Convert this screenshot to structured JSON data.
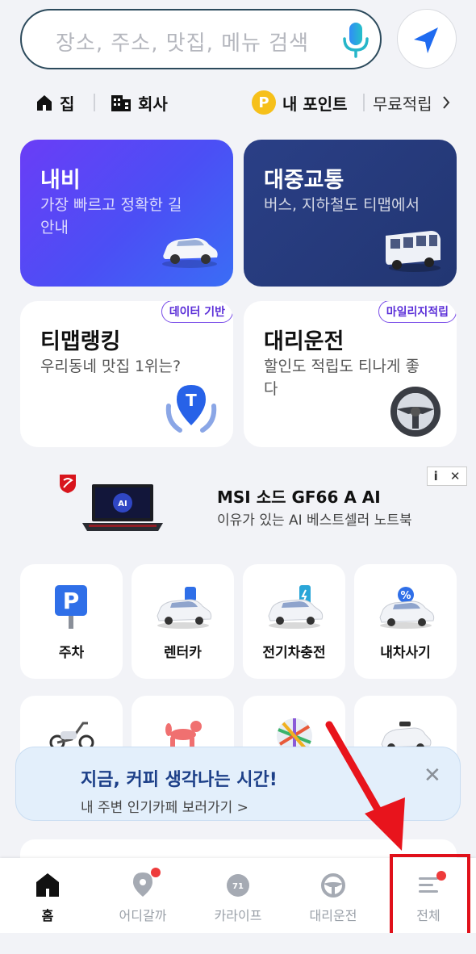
{
  "search": {
    "placeholder": "장소, 주소, 맛집, 메뉴 검색"
  },
  "quick_places": [
    {
      "label": "집"
    },
    {
      "label": "회사"
    }
  ],
  "points": {
    "coin": "P",
    "label": "내 포인트",
    "free_label": "무료적립"
  },
  "cards": {
    "navi": {
      "title": "내비",
      "sub": "가장 빠르고 정확한 길안내"
    },
    "transit": {
      "title": "대중교통",
      "sub": "버스, 지하철도 티맵에서"
    },
    "ranking": {
      "title": "티맵랭킹",
      "sub": "우리동네 맛집 1위는?",
      "tag": "데이터 기반"
    },
    "driver": {
      "title": "대리운전",
      "sub": "할인도 적립도 티나게 좋다",
      "tag": "마일리지적립"
    }
  },
  "ad": {
    "title": "MSI 소드 GF66 A AI",
    "sub": "이유가 있는 AI 베스트셀러 노트북",
    "info": "i",
    "close": "✕",
    "laptop_screen_text": "AI"
  },
  "services": [
    {
      "label": "주차",
      "sign": "P"
    },
    {
      "label": "렌터카"
    },
    {
      "label": "전기차충전"
    },
    {
      "label": "내차사기",
      "badge": "%"
    }
  ],
  "banner": {
    "title": "지금, 커피 생각나는 시간!",
    "sub": "내 주변 인기카페 보러가기 >",
    "close": "✕"
  },
  "tabbar": {
    "items": [
      {
        "label": "홈"
      },
      {
        "label": "어디갈까"
      },
      {
        "label": "카라이프",
        "badge": "71"
      },
      {
        "label": "대리운전"
      },
      {
        "label": "전체"
      }
    ]
  },
  "colors": {
    "accent_red": "#e0101a",
    "navi_gradient": "#5b46f5",
    "transit_bg": "#263c7c",
    "tag_purple": "#7a4ee8",
    "point_yellow": "#f6c01a"
  }
}
